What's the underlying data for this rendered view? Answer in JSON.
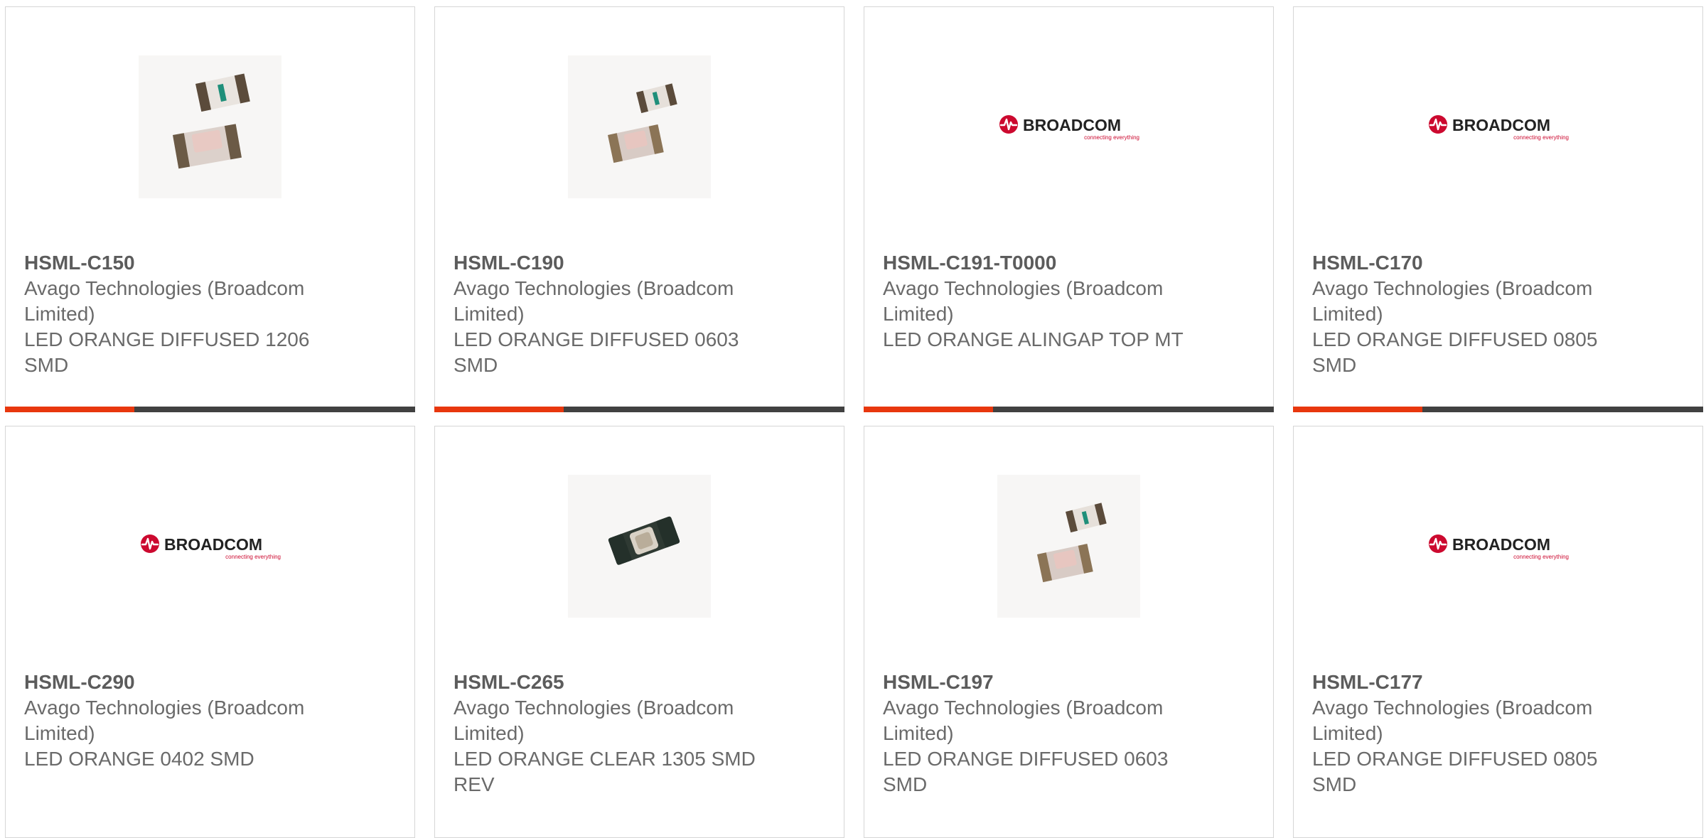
{
  "colors": {
    "accent": "#e8370e",
    "bar": "#414141",
    "broadcom_red": "#cc092f",
    "text": "#6a6a6a"
  },
  "products": [
    {
      "part": "HSML-C150",
      "manufacturer": "Avago Technologies (Broadcom Limited)",
      "description": "LED ORANGE DIFFUSED 1206 SMD",
      "image": "led-chip-photo"
    },
    {
      "part": "HSML-C190",
      "manufacturer": "Avago Technologies (Broadcom Limited)",
      "description": "LED ORANGE DIFFUSED 0603 SMD",
      "image": "led-chip-photo"
    },
    {
      "part": "HSML-C191-T0000",
      "manufacturer": "Avago Technologies (Broadcom Limited)",
      "description": "LED ORANGE ALINGAP TOP MT",
      "image": "broadcom-logo"
    },
    {
      "part": "HSML-C170",
      "manufacturer": "Avago Technologies (Broadcom Limited)",
      "description": "LED ORANGE DIFFUSED 0805 SMD",
      "image": "broadcom-logo"
    },
    {
      "part": "HSML-C290",
      "manufacturer": "Avago Technologies (Broadcom Limited)",
      "description": "LED ORANGE 0402 SMD",
      "image": "broadcom-logo"
    },
    {
      "part": "HSML-C265",
      "manufacturer": "Avago Technologies (Broadcom Limited)",
      "description": "LED ORANGE CLEAR 1305 SMD REV",
      "image": "led-reverse-photo"
    },
    {
      "part": "HSML-C197",
      "manufacturer": "Avago Technologies (Broadcom Limited)",
      "description": "LED ORANGE DIFFUSED 0603 SMD",
      "image": "led-chip-photo"
    },
    {
      "part": "HSML-C177",
      "manufacturer": "Avago Technologies (Broadcom Limited)",
      "description": "LED ORANGE DIFFUSED 0805 SMD",
      "image": "broadcom-logo"
    }
  ],
  "logo": {
    "brand": "BROADCOM",
    "tagline": "connecting everything"
  }
}
